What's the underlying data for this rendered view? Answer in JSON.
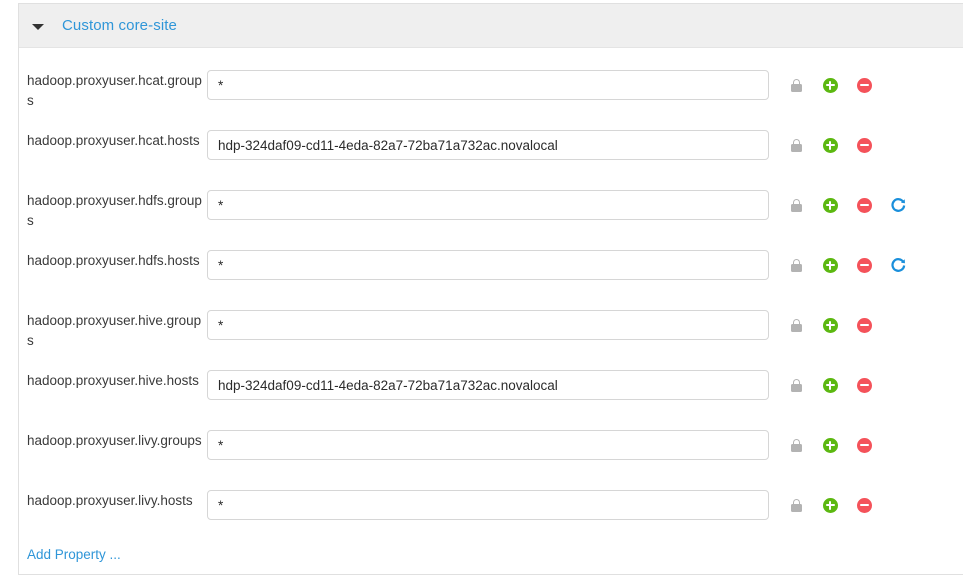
{
  "panel": {
    "title": "Custom core-site",
    "caret_icon": "caret-down-icon",
    "expanded": true,
    "add_property_label": "Add Property ...",
    "accent_color": "#2f96d8",
    "header_bg": "#efefef",
    "add_icon_color": "#5cb811",
    "remove_icon_color": "#f4525a",
    "revert_icon_color": "#1a8fdb",
    "lock_icon_color": "#b3b3b3"
  },
  "properties": [
    {
      "name": "hadoop.proxyuser.hcat.groups",
      "value": "*",
      "placeholder": "",
      "icons": [
        "lock-icon",
        "add-icon",
        "remove-icon"
      ],
      "has_revert": false
    },
    {
      "name": "hadoop.proxyuser.hcat.hosts",
      "value": "hdp-324daf09-cd11-4eda-82a7-72ba71a732ac.novalocal",
      "placeholder": "",
      "icons": [
        "lock-icon",
        "add-icon",
        "remove-icon"
      ],
      "has_revert": false
    },
    {
      "name": "hadoop.proxyuser.hdfs.groups",
      "value": "*",
      "placeholder": "",
      "icons": [
        "lock-icon",
        "add-icon",
        "remove-icon",
        "revert-icon"
      ],
      "has_revert": true
    },
    {
      "name": "hadoop.proxyuser.hdfs.hosts",
      "value": "*",
      "placeholder": "",
      "icons": [
        "lock-icon",
        "add-icon",
        "remove-icon",
        "revert-icon"
      ],
      "has_revert": true
    },
    {
      "name": "hadoop.proxyuser.hive.groups",
      "value": "*",
      "placeholder": "",
      "icons": [
        "lock-icon",
        "add-icon",
        "remove-icon"
      ],
      "has_revert": false
    },
    {
      "name": "hadoop.proxyuser.hive.hosts",
      "value": "hdp-324daf09-cd11-4eda-82a7-72ba71a732ac.novalocal",
      "placeholder": "",
      "icons": [
        "lock-icon",
        "add-icon",
        "remove-icon"
      ],
      "has_revert": false
    },
    {
      "name": "hadoop.proxyuser.livy.groups",
      "value": "*",
      "placeholder": "",
      "icons": [
        "lock-icon",
        "add-icon",
        "remove-icon"
      ],
      "has_revert": false
    },
    {
      "name": "hadoop.proxyuser.livy.hosts",
      "value": "*",
      "placeholder": "",
      "icons": [
        "lock-icon",
        "add-icon",
        "remove-icon"
      ],
      "has_revert": false
    }
  ]
}
